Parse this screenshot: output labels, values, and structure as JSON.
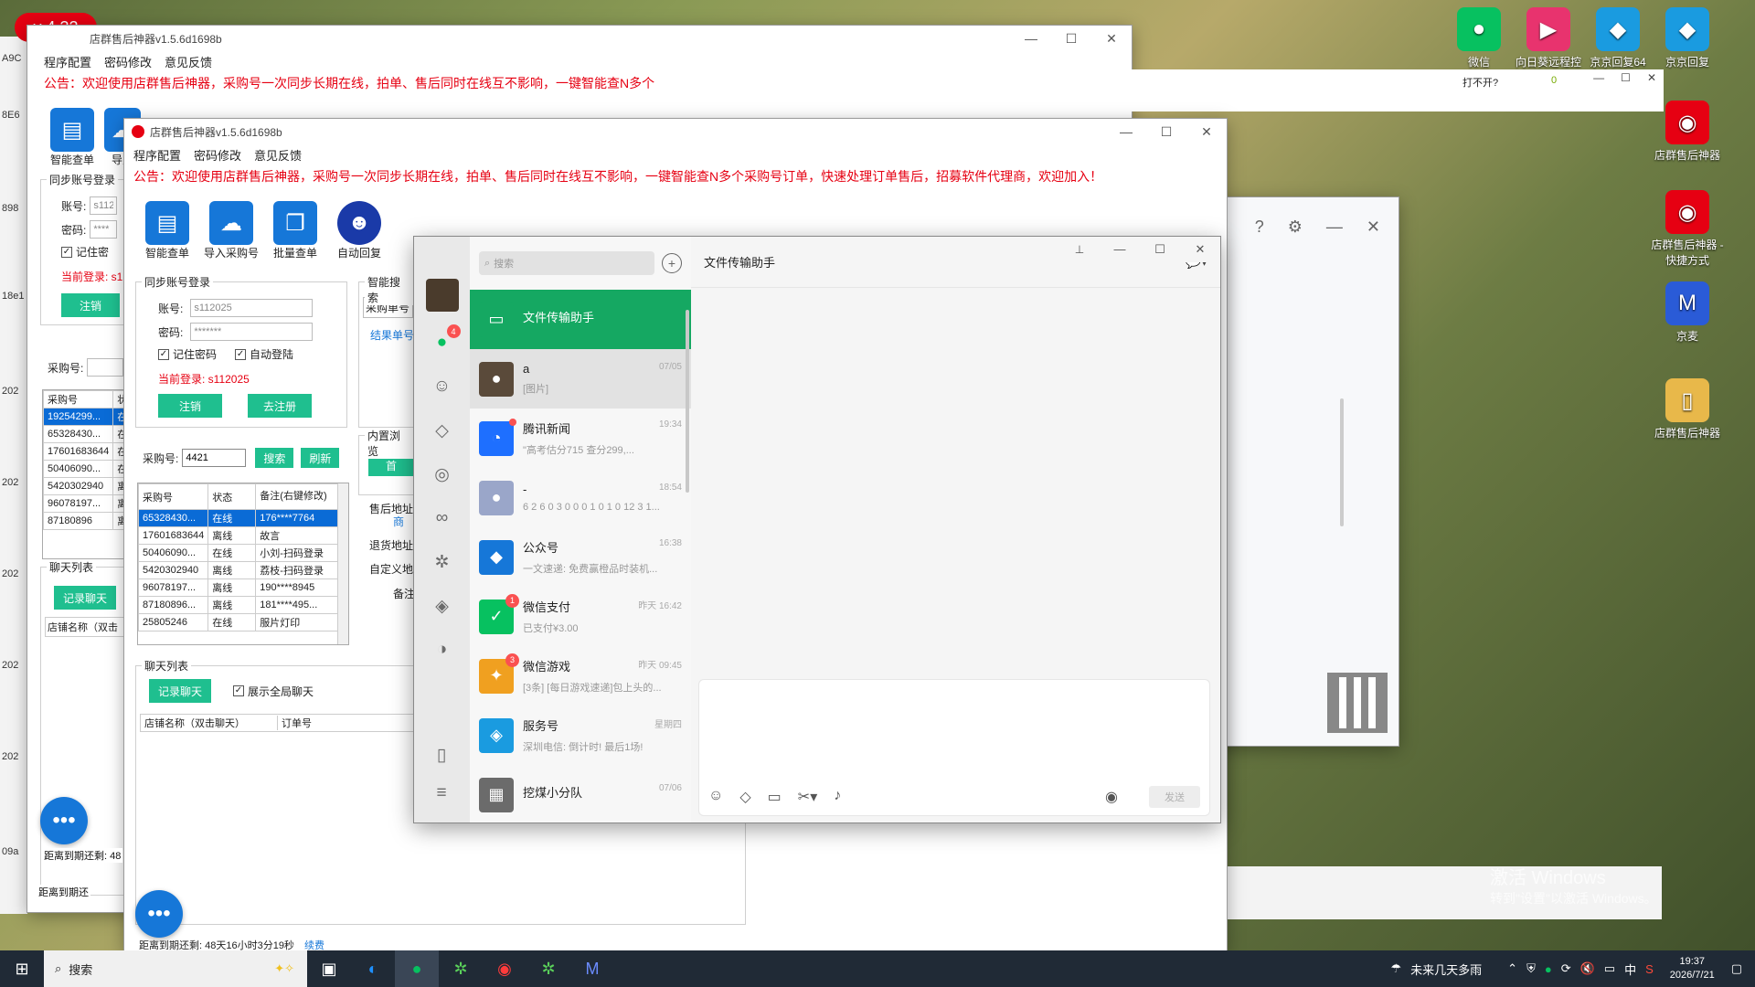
{
  "version_badge": "v 4.32",
  "desktop_icons": [
    {
      "label": "微信",
      "color": "#07c160",
      "icon": "wechat-icon"
    },
    {
      "label": "向日葵远程控",
      "color": "#e8336e",
      "icon": "sunlogin-icon"
    },
    {
      "label": "京京回复64",
      "color": "#1a9be0",
      "icon": "jingjing-icon"
    },
    {
      "label": "京京回复",
      "color": "#1a9be0",
      "icon": "jingjing-icon"
    },
    {
      "label": "店群售后神器",
      "color": "#e60012",
      "icon": "after-sales-icon"
    },
    {
      "label": "店群售后神器 - 快捷方式",
      "color": "#e60012",
      "icon": "after-sales-icon"
    },
    {
      "label": "京麦",
      "color": "#2a5bd7",
      "icon": "jingmai-icon"
    },
    {
      "label": "店群售后神器",
      "color": "#e8b84a",
      "icon": "folder-icon"
    }
  ],
  "bg_window": {
    "title": "店群售后神器v1.5.6d1698b",
    "notice": "公告：欢迎使用店群售后神器，采购号一次同步长期在线，拍单、售后同时在线互不影响，一键智能查N多个采购号订单，快速处理订单售后，招募软件代理商，欢迎加入！",
    "tool_smart": "智能查单",
    "tool_import": "导入",
    "sync_label": "同步账号登录",
    "account_label": "账号:",
    "account_value": "s112",
    "password_label": "密码:",
    "password_value": "****",
    "remember": "记住密",
    "current_login": "当前登录: s1",
    "logout": "注销",
    "purchase_label": "采购号:",
    "col_purchase": "采购号",
    "col_status": "状",
    "rows": [
      {
        "id": "19254299...",
        "st": "在"
      },
      {
        "id": "65328430...",
        "st": "在"
      },
      {
        "id": "17601683644",
        "st": "在"
      },
      {
        "id": "50406090...",
        "st": "在"
      },
      {
        "id": "5420302940",
        "st": "离"
      },
      {
        "id": "96078197...",
        "st": "离"
      },
      {
        "id": "87180896",
        "st": "离"
      }
    ],
    "chat_list": "聊天列表",
    "record_chat": "记录聊天",
    "store_col": "店铺名称（双击",
    "expiry": "距离到期还剩: 48"
  },
  "left_strip": {
    "labels": [
      "A9C",
      "8E6",
      "898",
      "18e1",
      "202",
      "202",
      "202",
      "202",
      "202",
      "09a"
    ],
    "expiry": "距离到期还"
  },
  "fg_window": {
    "title": "店群售后神器v1.5.6d1698b",
    "menu": [
      "程序配置",
      "密码修改",
      "意见反馈"
    ],
    "notice": "公告：欢迎使用店群售后神器，采购号一次同步长期在线，拍单、售后同时在线互不影响，一键智能查N多个采购号订单，快速处理订单售后，招募软件代理商，欢迎加入！",
    "tools": [
      "智能查单",
      "导入采购号",
      "批量查单",
      "自动回复"
    ],
    "sync_label": "同步账号登录",
    "account_label": "账号:",
    "account_value": "s112025",
    "password_label": "密码:",
    "password_value": "*******",
    "remember": "记住密码",
    "auto_login": "自动登陆",
    "current_login": "当前登录: s112025",
    "logout": "注销",
    "unregister": "去注册",
    "smart_search": "智能搜索",
    "purchase_order": "采购单号",
    "result_order": "结果单号",
    "builtin_browser": "内置浏览",
    "home": "首",
    "aftersale_addr": "售后地址",
    "aftersale_link": "商",
    "return_addr": "退货地址",
    "custom_addr": "自定义地址",
    "note": "备注",
    "purchase_label": "采购号:",
    "purchase_value": "4421",
    "search": "搜索",
    "refresh": "刷新",
    "cols": [
      "采购号",
      "状态",
      "备注(右键修改)"
    ],
    "rows": [
      {
        "id": "65328430...",
        "st": "在线",
        "note": "176****7764",
        "sel": true
      },
      {
        "id": "17601683644",
        "st": "离线",
        "note": "故言",
        "sel": false
      },
      {
        "id": "50406090...",
        "st": "在线",
        "note": "小刘-扫码登录",
        "sel": false
      },
      {
        "id": "5420302940",
        "st": "离线",
        "note": "荔枝-扫码登录",
        "sel": false
      },
      {
        "id": "96078197...",
        "st": "离线",
        "note": "190****8945",
        "sel": false
      },
      {
        "id": "87180896...",
        "st": "离线",
        "note": "181****495...",
        "sel": false
      },
      {
        "id": "25805246",
        "st": "在线",
        "note": "服片灯印",
        "sel": false
      }
    ],
    "chat_list": "聊天列表",
    "record_chat": "记录聊天",
    "show_all_chat": "展示全局聊天",
    "store_col": "店铺名称（双击聊天）",
    "order_col": "订单号",
    "expiry": "距离到期还剩: 48天16小时3分19秒",
    "renew": "续费"
  },
  "jingmai": {
    "logo_text": "京麦",
    "unopened": "打不开?",
    "zero": "0"
  },
  "wechat": {
    "search_placeholder": "搜索",
    "chat_title": "文件传输助手",
    "send": "发送",
    "nav_badge": "4",
    "chats": [
      {
        "name": "文件传输助手",
        "time": "",
        "preview": "",
        "color": "#15a862",
        "icon": "folder-icon",
        "badge": "",
        "dot": false,
        "state": "active"
      },
      {
        "name": "a",
        "time": "07/05",
        "preview": "[图片]",
        "color": "#5a4a3a",
        "icon": "avatar-icon",
        "badge": "",
        "dot": false,
        "state": "hover"
      },
      {
        "name": "腾讯新闻",
        "time": "19:34",
        "preview": "\"高考估分715 查分299,...",
        "color": "#1e6fff",
        "icon": "news-icon",
        "badge": "",
        "dot": true,
        "state": ""
      },
      {
        "name": "-",
        "time": "18:54",
        "preview": "6 2 6 0 3 0 0 0 1 0 1 0 12 3 1...",
        "color": "#9aa6c9",
        "icon": "avatar-icon",
        "badge": "",
        "dot": false,
        "state": ""
      },
      {
        "name": "公众号",
        "time": "16:38",
        "preview": "一文速递: 免费赢橙品时装机...",
        "color": "#1677d8",
        "icon": "official-account-icon",
        "badge": "",
        "dot": false,
        "state": ""
      },
      {
        "name": "微信支付",
        "time": "昨天 16:42",
        "preview": "已支付¥3.00",
        "color": "#07c160",
        "icon": "pay-icon",
        "badge": "1",
        "dot": false,
        "state": ""
      },
      {
        "name": "微信游戏",
        "time": "昨天 09:45",
        "preview": "[3条] [每日游戏速递]包上头的...",
        "color": "#f0a020",
        "icon": "game-icon",
        "badge": "3",
        "dot": false,
        "state": ""
      },
      {
        "name": "服务号",
        "time": "星期四",
        "preview": "深圳电信: 倒计时! 最后1场!",
        "color": "#1a9be0",
        "icon": "service-icon",
        "badge": "",
        "dot": false,
        "state": ""
      },
      {
        "name": "挖煤小分队",
        "time": "07/06",
        "preview": "",
        "color": "#6b6b6b",
        "icon": "group-icon",
        "badge": "",
        "dot": false,
        "state": ""
      }
    ]
  },
  "windows_watermark": {
    "line1": "激活 Windows",
    "line2": "转到\"设置\"以激活 Windows。"
  },
  "taskbar": {
    "search": "搜索",
    "weather": "未来几天多雨",
    "time": "19:37",
    "date": "2026/7/21",
    "ime": "中"
  }
}
